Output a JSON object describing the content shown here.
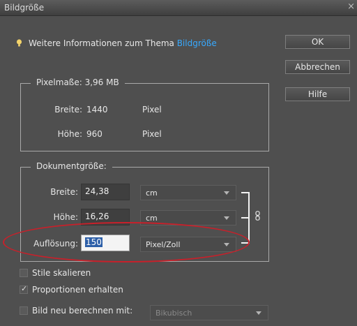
{
  "window": {
    "title": "Bildgröße"
  },
  "info": {
    "text": "Weitere Informationen zum Thema",
    "link": "Bildgröße"
  },
  "buttons": {
    "ok": "OK",
    "cancel": "Abbrechen",
    "help": "Hilfe"
  },
  "pixel_dimensions": {
    "legend": "Pixelmaße: 3,96 MB",
    "width_label": "Breite:",
    "width_value": "1440",
    "width_unit": "Pixel",
    "height_label": "Höhe:",
    "height_value": "960",
    "height_unit": "Pixel"
  },
  "document_size": {
    "legend": "Dokumentgröße:",
    "width_label": "Breite:",
    "width_value": "24,38",
    "width_unit": "cm",
    "height_label": "Höhe:",
    "height_value": "16,26",
    "height_unit": "cm",
    "resolution_label": "Auflösung:",
    "resolution_value": "150",
    "resolution_unit": "Pixel/Zoll"
  },
  "options": {
    "scale_styles": {
      "label": "Stile skalieren",
      "checked": false
    },
    "constrain": {
      "label": "Proportionen erhalten",
      "checked": true
    },
    "resample": {
      "label": "Bild neu berechnen mit:",
      "checked": false,
      "method": "Bikubisch"
    }
  },
  "colors": {
    "accent_link": "#37a9ff",
    "highlight_oval": "#c8202a"
  },
  "icons": {
    "info": "lightbulb-icon",
    "constrain_link": "chain-link-icon",
    "close": "close-icon"
  }
}
